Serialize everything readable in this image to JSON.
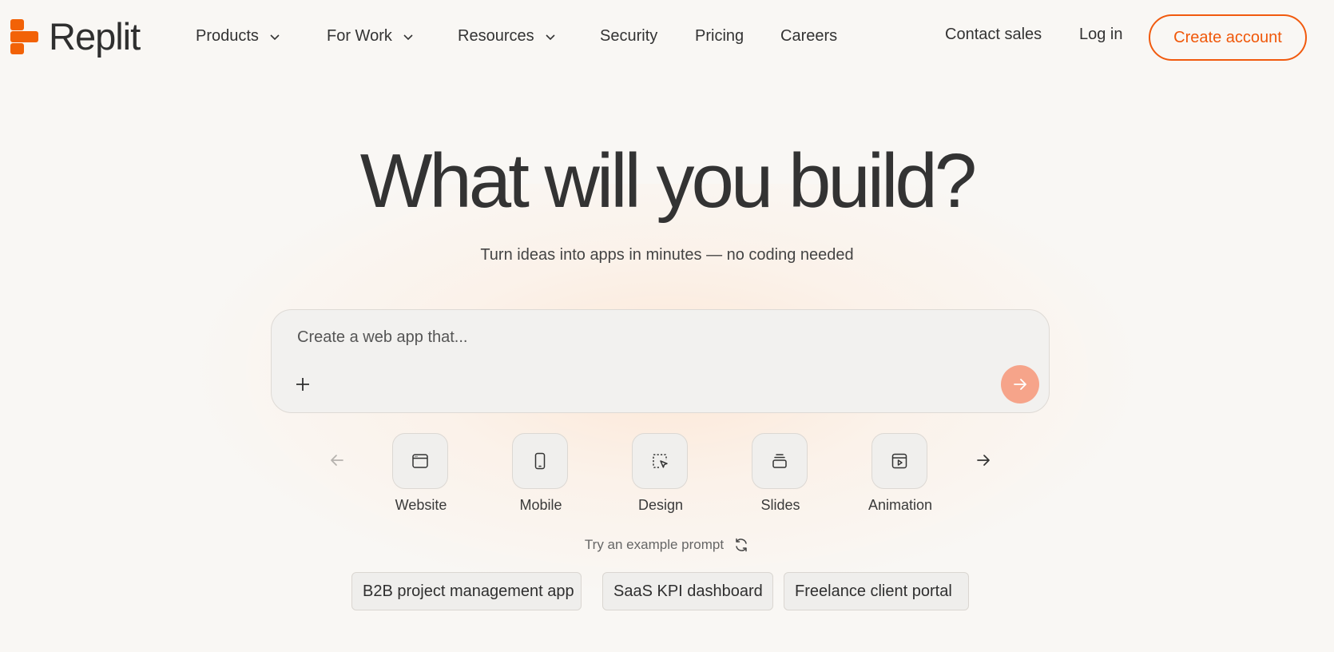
{
  "brand": {
    "name": "Replit",
    "accent": "#f26207"
  },
  "nav": {
    "items": [
      {
        "label": "Products",
        "has_dropdown": true
      },
      {
        "label": "For Work",
        "has_dropdown": true
      },
      {
        "label": "Resources",
        "has_dropdown": true
      },
      {
        "label": "Security",
        "has_dropdown": false
      },
      {
        "label": "Pricing",
        "has_dropdown": false
      },
      {
        "label": "Careers",
        "has_dropdown": false
      }
    ],
    "contact_sales": "Contact sales",
    "login": "Log in",
    "create_account": "Create account"
  },
  "hero": {
    "title": "What will you build?",
    "subtitle": "Turn ideas into apps in minutes — no coding needed"
  },
  "prompt": {
    "placeholder": "Create a web app that...",
    "value": ""
  },
  "categories": [
    {
      "label": "Website",
      "icon": "browser-window-icon"
    },
    {
      "label": "Mobile",
      "icon": "phone-icon"
    },
    {
      "label": "Design",
      "icon": "selection-cursor-icon"
    },
    {
      "label": "Slides",
      "icon": "slides-stack-icon"
    },
    {
      "label": "Animation",
      "icon": "video-play-icon"
    }
  ],
  "examples": {
    "label": "Try an example prompt",
    "chips": [
      "B2B project management app",
      "SaaS KPI dashboard",
      "Freelance client portal"
    ]
  }
}
